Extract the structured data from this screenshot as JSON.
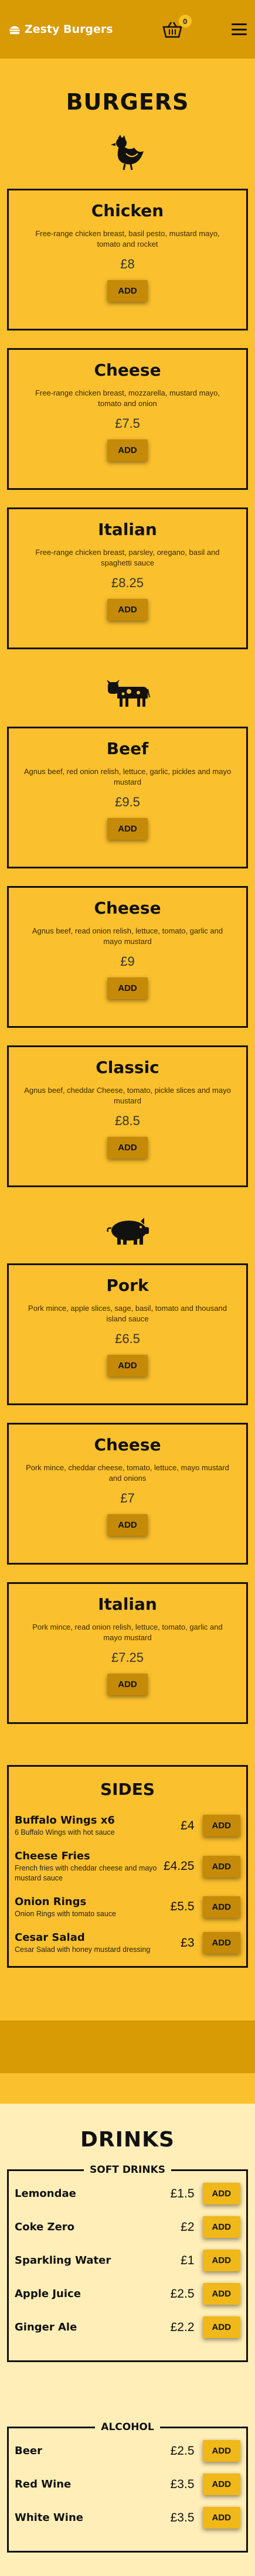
{
  "brand": {
    "name": "Zesty Burgers"
  },
  "cart": {
    "count": "0"
  },
  "burgers": {
    "title": "BURGERS",
    "add_label": "ADD",
    "categories": [
      {
        "icon": "chicken-icon",
        "items": [
          {
            "name": "Chicken",
            "desc": "Free-range chicken breast, basil pesto, mustard mayo, tomato and rocket",
            "price": "£8"
          },
          {
            "name": "Cheese",
            "desc": "Free-range chicken breast, mozzarella, mustard mayo, tomato and onion",
            "price": "£7.5"
          },
          {
            "name": "Italian",
            "desc": "Free-range chicken breast, parsley, oregano, basil and spaghetti sauce",
            "price": "£8.25"
          }
        ]
      },
      {
        "icon": "cow-icon",
        "items": [
          {
            "name": "Beef",
            "desc": "Agnus beef, red onion relish, lettuce, garlic, pickles and mayo mustard",
            "price": "£9.5"
          },
          {
            "name": "Cheese",
            "desc": "Agnus beef, read onion relish, lettuce, tomato, garlic and mayo mustard",
            "price": "£9"
          },
          {
            "name": "Classic",
            "desc": "Agnus beef, cheddar Cheese, tomato, pickle slices and mayo mustard",
            "price": "£8.5"
          }
        ]
      },
      {
        "icon": "pig-icon",
        "items": [
          {
            "name": "Pork",
            "desc": "Pork mince, apple slices, sage, basil, tomato and thousand island sauce",
            "price": "£6.5"
          },
          {
            "name": "Cheese",
            "desc": "Pork mince, cheddar cheese, tomato, lettuce, mayo mustard and onions",
            "price": "£7"
          },
          {
            "name": "Italian",
            "desc": "Pork mince, read onion relish, lettuce, tomato, garlic and mayo mustard",
            "price": "£7.25"
          }
        ]
      }
    ]
  },
  "sides": {
    "title": "SIDES",
    "items": [
      {
        "name": "Buffalo Wings x6",
        "desc": "6 Buffalo Wings with hot sauce",
        "price": "£4"
      },
      {
        "name": "Cheese Fries",
        "desc": "French fries with cheddar cheese and mayo mustard sauce",
        "price": "£4.25"
      },
      {
        "name": "Onion Rings",
        "desc": "Onion Rings with tomato sauce",
        "price": "£5.5"
      },
      {
        "name": "Cesar Salad",
        "desc": "Cesar Salad with honey mustard dressing",
        "price": "£3"
      }
    ]
  },
  "drinks": {
    "title": "DRINKS",
    "groups": [
      {
        "label": "SOFT DRINKS",
        "items": [
          {
            "name": "Lemondae",
            "price": "£1.5"
          },
          {
            "name": "Coke Zero",
            "price": "£2"
          },
          {
            "name": "Sparkling Water",
            "price": "£1"
          },
          {
            "name": "Apple Juice",
            "price": "£2.5"
          },
          {
            "name": "Ginger Ale",
            "price": "£2.2"
          }
        ]
      },
      {
        "label": "ALCOHOL",
        "items": [
          {
            "name": "Beer",
            "price": "£2.5"
          },
          {
            "name": "Red Wine",
            "price": "£3.5"
          },
          {
            "name": "White Wine",
            "price": "£3.5"
          }
        ]
      }
    ]
  },
  "colors": {
    "header": "#d89a05",
    "page": "#fbc02d",
    "drinks_bg": "#ffeeb8",
    "button": "#c48a08"
  }
}
